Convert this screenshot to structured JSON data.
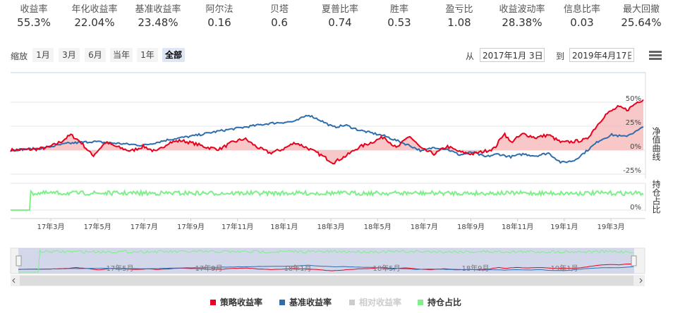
{
  "stats": [
    {
      "label": "收益率",
      "value": "55.3%"
    },
    {
      "label": "年化收益率",
      "value": "22.04%"
    },
    {
      "label": "基准收益率",
      "value": "23.48%"
    },
    {
      "label": "阿尔法",
      "value": "0.16"
    },
    {
      "label": "贝塔",
      "value": "0.6"
    },
    {
      "label": "夏普比率",
      "value": "0.74"
    },
    {
      "label": "胜率",
      "value": "0.53"
    },
    {
      "label": "盈亏比",
      "value": "1.08"
    },
    {
      "label": "收益波动率",
      "value": "28.38%"
    },
    {
      "label": "信息比率",
      "value": "0.03"
    },
    {
      "label": "最大回撤",
      "value": "25.64%"
    }
  ],
  "toolbar": {
    "zoom_label": "缩放",
    "zoom_buttons": [
      "1月",
      "3月",
      "6月",
      "当年",
      "1年",
      "全部"
    ],
    "active_zoom": "全部",
    "from_label": "从",
    "from_value": "2017年1月 3日",
    "to_label": "到",
    "to_value": "2019年4月17日"
  },
  "chart_data": {
    "type": "line",
    "x_start": "2017-01-03",
    "x_end": "2019-04-17",
    "x_ticks": [
      "17年3月",
      "17年5月",
      "17年7月",
      "17年9月",
      "17年11月",
      "18年1月",
      "18年3月",
      "18年5月",
      "18年7月",
      "18年9月",
      "18年11月",
      "19年1月",
      "19年3月"
    ],
    "navigator_ticks": [
      "17年5月",
      "17年9月",
      "18年1月",
      "18年5月",
      "18年9月",
      "19年1月"
    ],
    "y_ticks_nav": [
      "50%",
      "25%",
      "0%",
      "-25%"
    ],
    "y_ticks_pos": [
      "0%"
    ],
    "y_title_nav": "净值曲线",
    "y_title_pos": "持仓占比",
    "ylim_nav": [
      -25,
      50
    ],
    "series": [
      {
        "name": "策略收益率",
        "color": "#e8001c",
        "key": "strategy",
        "points": [
          [
            0,
            0
          ],
          [
            0.04,
            1
          ],
          [
            0.06,
            3
          ],
          [
            0.08,
            9
          ],
          [
            0.095,
            16
          ],
          [
            0.11,
            9
          ],
          [
            0.13,
            -6
          ],
          [
            0.15,
            8
          ],
          [
            0.17,
            3
          ],
          [
            0.19,
            -1
          ],
          [
            0.21,
            4
          ],
          [
            0.23,
            -2
          ],
          [
            0.25,
            8
          ],
          [
            0.27,
            10
          ],
          [
            0.29,
            7
          ],
          [
            0.31,
            3
          ],
          [
            0.33,
            1
          ],
          [
            0.35,
            8
          ],
          [
            0.37,
            12
          ],
          [
            0.39,
            3
          ],
          [
            0.41,
            -3
          ],
          [
            0.43,
            1
          ],
          [
            0.45,
            8
          ],
          [
            0.47,
            2
          ],
          [
            0.49,
            -5
          ],
          [
            0.51,
            -13
          ],
          [
            0.53,
            -6
          ],
          [
            0.55,
            3
          ],
          [
            0.57,
            8
          ],
          [
            0.59,
            14
          ],
          [
            0.61,
            2
          ],
          [
            0.63,
            15
          ],
          [
            0.65,
            1
          ],
          [
            0.67,
            -4
          ],
          [
            0.69,
            4
          ],
          [
            0.71,
            -2
          ],
          [
            0.73,
            -4
          ],
          [
            0.75,
            -1
          ],
          [
            0.765,
            2
          ],
          [
            0.78,
            18
          ],
          [
            0.79,
            8
          ],
          [
            0.81,
            17
          ],
          [
            0.83,
            13
          ],
          [
            0.85,
            16
          ],
          [
            0.87,
            8
          ],
          [
            0.89,
            9
          ],
          [
            0.91,
            11
          ],
          [
            0.92,
            20
          ],
          [
            0.94,
            37
          ],
          [
            0.96,
            45
          ],
          [
            0.975,
            42
          ],
          [
            0.99,
            50
          ],
          [
            1.0,
            53
          ]
        ]
      },
      {
        "name": "基准收益率",
        "color": "#2f6ead",
        "key": "benchmark",
        "points": [
          [
            0,
            0
          ],
          [
            0.05,
            2
          ],
          [
            0.09,
            7
          ],
          [
            0.13,
            9
          ],
          [
            0.17,
            7
          ],
          [
            0.21,
            5
          ],
          [
            0.25,
            11
          ],
          [
            0.29,
            15
          ],
          [
            0.33,
            20
          ],
          [
            0.37,
            24
          ],
          [
            0.41,
            28
          ],
          [
            0.45,
            30
          ],
          [
            0.47,
            37
          ],
          [
            0.49,
            31
          ],
          [
            0.51,
            24
          ],
          [
            0.53,
            26
          ],
          [
            0.55,
            21
          ],
          [
            0.57,
            18
          ],
          [
            0.59,
            15
          ],
          [
            0.61,
            10
          ],
          [
            0.63,
            5
          ],
          [
            0.65,
            -1
          ],
          [
            0.67,
            3
          ],
          [
            0.69,
            1
          ],
          [
            0.71,
            -5
          ],
          [
            0.73,
            -2
          ],
          [
            0.75,
            -7
          ],
          [
            0.77,
            -4
          ],
          [
            0.79,
            -7
          ],
          [
            0.81,
            -4
          ],
          [
            0.83,
            -6
          ],
          [
            0.85,
            -3
          ],
          [
            0.87,
            -13
          ],
          [
            0.89,
            -11
          ],
          [
            0.91,
            -1
          ],
          [
            0.93,
            10
          ],
          [
            0.95,
            16
          ],
          [
            0.97,
            14
          ],
          [
            0.99,
            20
          ],
          [
            1.0,
            24
          ]
        ]
      },
      {
        "name": "相对收益率",
        "color": "#cccccc",
        "key": "relative",
        "hidden": true,
        "points": []
      },
      {
        "name": "持仓占比",
        "color": "#7ef08a",
        "key": "position",
        "points": [
          [
            0,
            0
          ],
          [
            0.035,
            0
          ],
          [
            0.038,
            1
          ],
          [
            0.04,
            1
          ]
        ]
      }
    ]
  }
}
